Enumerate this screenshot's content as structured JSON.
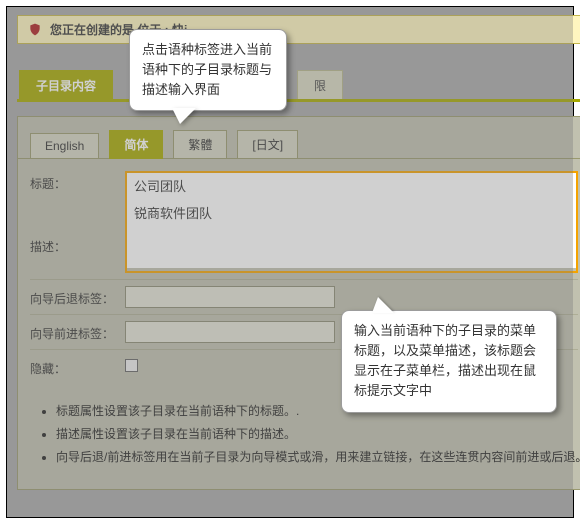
{
  "alert": {
    "text": "您正在创建的是                                       位于 : 快j"
  },
  "topTabs": {
    "active": "子目录内容",
    "other": "限"
  },
  "langTabs": {
    "items": [
      "English",
      "简体",
      "繁體",
      "[日文]"
    ],
    "activeIndex": 1
  },
  "form": {
    "title_label": "标题：",
    "title_value": "公司团队",
    "desc_label": "描述：",
    "desc_value": "锐商软件团队",
    "back_label": "向导后退标签：",
    "back_value": "",
    "fwd_label": "向导前进标签：",
    "fwd_value": "",
    "hide_label": "隐藏："
  },
  "bullets": [
    "标题属性设置该子目录在当前语种下的标题。.",
    "描述属性设置该子目录在当前语种下的描述。",
    "向导后退/前进标签用在当前子目录为向导模式或滑，用来建立链接，在这些连贯内容间前进或后退。"
  ],
  "callouts": {
    "top": "点击语种标签进入当前语种下的子目录标题与描述输入界面",
    "bottom": "输入当前语种下的子目录的菜单标题，以及菜单描述，该标题会显示在子菜单栏，描述出现在鼠标提示文字中"
  }
}
